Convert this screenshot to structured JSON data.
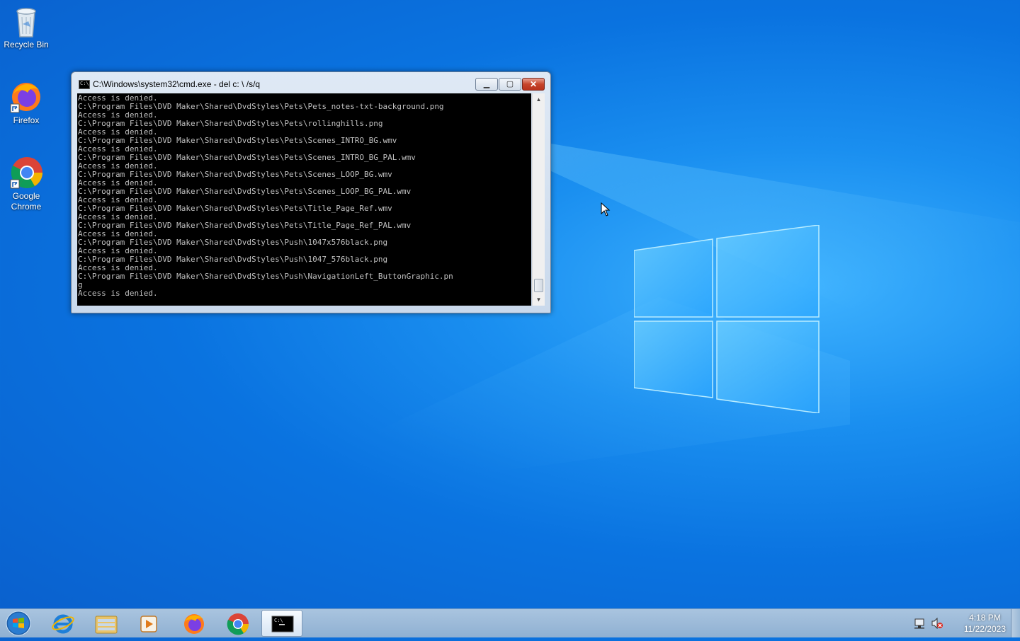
{
  "desktop": {
    "icons": [
      {
        "label": "Recycle Bin"
      },
      {
        "label": "Firefox"
      },
      {
        "label": "Google Chrome"
      }
    ]
  },
  "cmd_window": {
    "title": "C:\\Windows\\system32\\cmd.exe - del  c: \\ /s/q",
    "output": "Access is denied.\nC:\\Program Files\\DVD Maker\\Shared\\DvdStyles\\Pets\\Pets_notes-txt-background.png\nAccess is denied.\nC:\\Program Files\\DVD Maker\\Shared\\DvdStyles\\Pets\\rollinghills.png\nAccess is denied.\nC:\\Program Files\\DVD Maker\\Shared\\DvdStyles\\Pets\\Scenes_INTRO_BG.wmv\nAccess is denied.\nC:\\Program Files\\DVD Maker\\Shared\\DvdStyles\\Pets\\Scenes_INTRO_BG_PAL.wmv\nAccess is denied.\nC:\\Program Files\\DVD Maker\\Shared\\DvdStyles\\Pets\\Scenes_LOOP_BG.wmv\nAccess is denied.\nC:\\Program Files\\DVD Maker\\Shared\\DvdStyles\\Pets\\Scenes_LOOP_BG_PAL.wmv\nAccess is denied.\nC:\\Program Files\\DVD Maker\\Shared\\DvdStyles\\Pets\\Title_Page_Ref.wmv\nAccess is denied.\nC:\\Program Files\\DVD Maker\\Shared\\DvdStyles\\Pets\\Title_Page_Ref_PAL.wmv\nAccess is denied.\nC:\\Program Files\\DVD Maker\\Shared\\DvdStyles\\Push\\1047x576black.png\nAccess is denied.\nC:\\Program Files\\DVD Maker\\Shared\\DvdStyles\\Push\\1047_576black.png\nAccess is denied.\nC:\\Program Files\\DVD Maker\\Shared\\DvdStyles\\Push\\NavigationLeft_ButtonGraphic.pn\ng\nAccess is denied.",
    "icon_text": "C:\\"
  },
  "taskbar": {
    "items": [
      {
        "icon": "internet-explorer-icon"
      },
      {
        "icon": "file-explorer-icon"
      },
      {
        "icon": "media-player-icon"
      },
      {
        "icon": "firefox-icon"
      },
      {
        "icon": "chrome-icon"
      },
      {
        "icon": "cmd-icon",
        "active": true
      }
    ],
    "clock": {
      "time": "4:18 PM",
      "date": "11/22/2023"
    }
  },
  "colors": {
    "desktop": "#0a73e0",
    "console_bg": "#000000",
    "console_fg": "#c0c0c0"
  }
}
